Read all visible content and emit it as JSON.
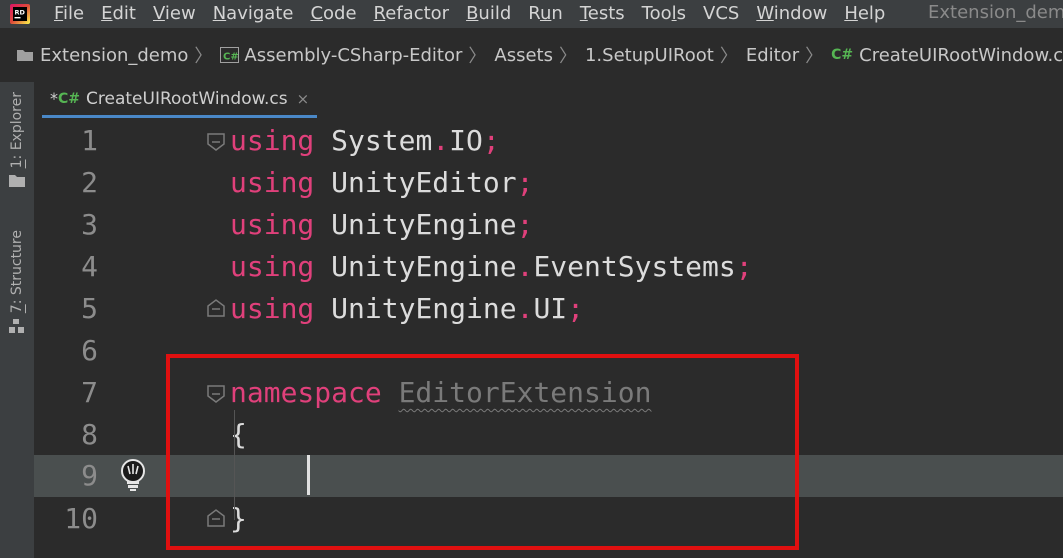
{
  "menubar": {
    "items": [
      {
        "mnemonic": "F",
        "rest": "ile"
      },
      {
        "mnemonic": "E",
        "rest": "dit"
      },
      {
        "mnemonic": "V",
        "rest": "iew"
      },
      {
        "mnemonic": "N",
        "rest": "avigate"
      },
      {
        "mnemonic": "C",
        "rest": "ode"
      },
      {
        "mnemonic": "R",
        "rest": "efactor"
      },
      {
        "mnemonic": "B",
        "rest": "uild"
      },
      {
        "mnemonic": "R",
        "rest": "un",
        "pre": ""
      },
      {
        "mnemonic": "T",
        "rest": "ests"
      },
      {
        "mnemonic": "",
        "rest": "Tools"
      },
      {
        "mnemonic": "",
        "rest": "VCS"
      },
      {
        "mnemonic": "W",
        "rest": "indow"
      },
      {
        "mnemonic": "H",
        "rest": "elp"
      }
    ],
    "window_title": "Extension_demo"
  },
  "breadcrumb": {
    "project": "Extension_demo",
    "assembly": "Assembly-CSharp-Editor",
    "folders": [
      "Assets",
      "1.SetupUIRoot",
      "Editor"
    ],
    "csharp_tag": "C#",
    "file": "CreateUIRootWindow.cs"
  },
  "tool_windows": {
    "explorer": {
      "number": "1",
      "rest": ": Explorer"
    },
    "structure": {
      "number": "7",
      "rest": ": Structure"
    }
  },
  "tab": {
    "modified_marker": "*",
    "csharp_tag": "C#",
    "label": "CreateUIRootWindow.cs",
    "close": "×"
  },
  "editor": {
    "line_numbers": [
      "1",
      "2",
      "3",
      "4",
      "5",
      "6",
      "7",
      "8",
      "9",
      "10"
    ],
    "lines": [
      {
        "kw": "using",
        "id": "System",
        "dot": ".",
        "id2": "IO",
        "semi": ";"
      },
      {
        "kw": "using",
        "id": "UnityEditor",
        "semi": ";"
      },
      {
        "kw": "using",
        "id": "UnityEngine",
        "semi": ";"
      },
      {
        "kw": "using",
        "id": "UnityEngine",
        "dot": ".",
        "id2": "EventSystems",
        "semi": ";"
      },
      {
        "kw": "using",
        "id": "UnityEngine",
        "dot": ".",
        "id2": "UI",
        "semi": ";"
      }
    ],
    "namespace_kw": "namespace",
    "namespace_name": "EditorExtension",
    "open_brace": "{",
    "close_brace": "}",
    "current_line": 9
  },
  "colors": {
    "keyword": "#e0407b",
    "highlight_box": "#e01010",
    "csharp": "#56b553"
  }
}
